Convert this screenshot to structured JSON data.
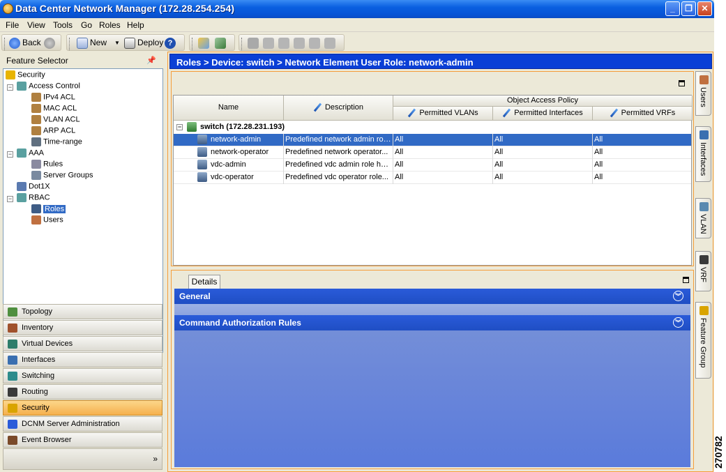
{
  "window": {
    "title": "Data Center Network Manager (172.28.254.254)",
    "controls": [
      "_",
      "❐",
      "✕"
    ]
  },
  "menu": [
    "File",
    "View",
    "Tools",
    "Go",
    "Roles",
    "Help"
  ],
  "toolbar": {
    "back_label": "Back",
    "new_label": "New",
    "deploy_label": "Deploy",
    "help_glyph": "?"
  },
  "feature_selector": {
    "title": "Feature Selector",
    "tree": [
      {
        "label": "Security",
        "icon": "lock-icon"
      },
      {
        "label": "Access Control",
        "icon": "cube-icon"
      },
      {
        "label": "IPv4 ACL",
        "icon": "acl-icon"
      },
      {
        "label": "MAC ACL",
        "icon": "acl-icon"
      },
      {
        "label": "VLAN ACL",
        "icon": "acl-icon"
      },
      {
        "label": "ARP ACL",
        "icon": "acl-icon"
      },
      {
        "label": "Time-range",
        "icon": "clock-icon"
      },
      {
        "label": "AAA",
        "icon": "cube-icon"
      },
      {
        "label": "Rules",
        "icon": "rules-icon"
      },
      {
        "label": "Server Groups",
        "icon": "server-icon"
      },
      {
        "label": "Dot1X",
        "icon": "dot1x-icon"
      },
      {
        "label": "RBAC",
        "icon": "cube-icon"
      },
      {
        "label": "Roles",
        "icon": "role-icon"
      },
      {
        "label": "Users",
        "icon": "users-icon"
      }
    ]
  },
  "nav_buttons": [
    {
      "label": "Topology",
      "color": "#4f8f3f"
    },
    {
      "label": "Inventory",
      "color": "#a0522d"
    },
    {
      "label": "Virtual Devices",
      "color": "#2e7d6b"
    },
    {
      "label": "Interfaces",
      "color": "#3a6fb0"
    },
    {
      "label": "Switching",
      "color": "#2e8c8c"
    },
    {
      "label": "Routing",
      "color": "#3a3a3a"
    },
    {
      "label": "Security",
      "color": "#d9a400"
    },
    {
      "label": "DCNM Server Administration",
      "color": "#2a5bd9"
    },
    {
      "label": "Event Browser",
      "color": "#7a4a2a"
    }
  ],
  "nav_footer": "»",
  "breadcrumb": "Roles > Device: switch > Network Element User Role: network-admin",
  "table": {
    "col_name": "Name",
    "col_description": "Description",
    "group_header": "Object Access Policy",
    "col_vlans": "Permitted VLANs",
    "col_interfaces": "Permitted Interfaces",
    "col_vrfs": "Permitted VRFs",
    "device": "switch (172.28.231.193)",
    "rows": [
      {
        "name": "network-admin",
        "description": "Predefined network admin rol...",
        "vlans": "All",
        "interfaces": "All",
        "vrfs": "All"
      },
      {
        "name": "network-operator",
        "description": "Predefined network operator...",
        "vlans": "All",
        "interfaces": "All",
        "vrfs": "All"
      },
      {
        "name": "vdc-admin",
        "description": "Predefined vdc admin role ha...",
        "vlans": "All",
        "interfaces": "All",
        "vrfs": "All"
      },
      {
        "name": "vdc-operator",
        "description": "Predefined vdc operator role...",
        "vlans": "All",
        "interfaces": "All",
        "vrfs": "All"
      }
    ]
  },
  "details": {
    "tab": "Details",
    "sections": [
      "General",
      "Command Authorization Rules"
    ]
  },
  "side_tabs": [
    "Users",
    "Interfaces",
    "VLAN",
    "VRF",
    "Feature Group"
  ],
  "figure_number": "270782"
}
